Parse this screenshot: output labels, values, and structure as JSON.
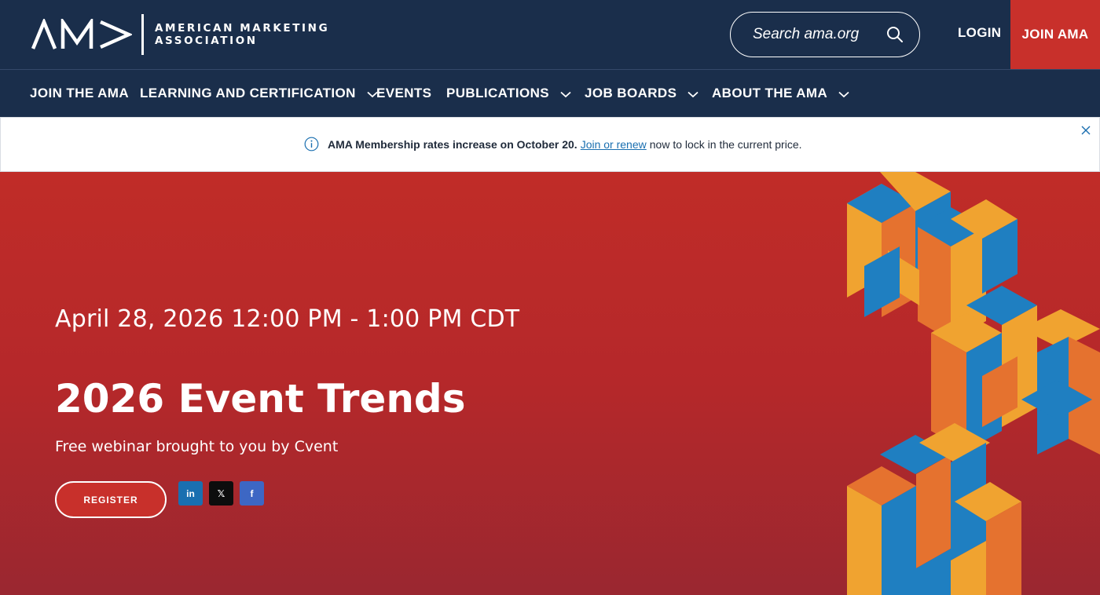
{
  "header": {
    "logo_line1": "AMERICAN MARKETING",
    "logo_line2": "ASSOCIATION",
    "search_placeholder": "Search ama.org",
    "login_label": "LOGIN",
    "join_label": "JOIN AMA"
  },
  "nav": {
    "items": [
      {
        "label": "JOIN THE AMA",
        "has_dropdown": false
      },
      {
        "label": "LEARNING AND CERTIFICATION",
        "has_dropdown": true
      },
      {
        "label": "EVENTS",
        "has_dropdown": false
      },
      {
        "label": "PUBLICATIONS",
        "has_dropdown": true
      },
      {
        "label": "JOB BOARDS",
        "has_dropdown": true
      },
      {
        "label": "ABOUT THE AMA",
        "has_dropdown": true
      }
    ]
  },
  "alert": {
    "bold_text": "AMA Membership rates increase on October 20.",
    "link_text": "Join or renew",
    "rest_text": "now to lock in the current price."
  },
  "hero": {
    "date": "April 28, 2026 12:00 PM - 1:00 PM CDT",
    "title": "2026 Event Trends",
    "subtitle": "Free webinar brought to you by Cvent",
    "register_label": "REGISTER",
    "share": {
      "linkedin": "in",
      "x": "𝕏",
      "facebook": "f"
    }
  },
  "colors": {
    "navy": "#1a2e4b",
    "red": "#c8302b",
    "link_blue": "#1a6fb0",
    "art_orange": "#f0a330",
    "art_blue": "#1f7fc1"
  },
  "icons": {
    "search": "search-icon",
    "info": "info-icon",
    "close": "close-icon",
    "chevron": "chevron-down-icon"
  }
}
